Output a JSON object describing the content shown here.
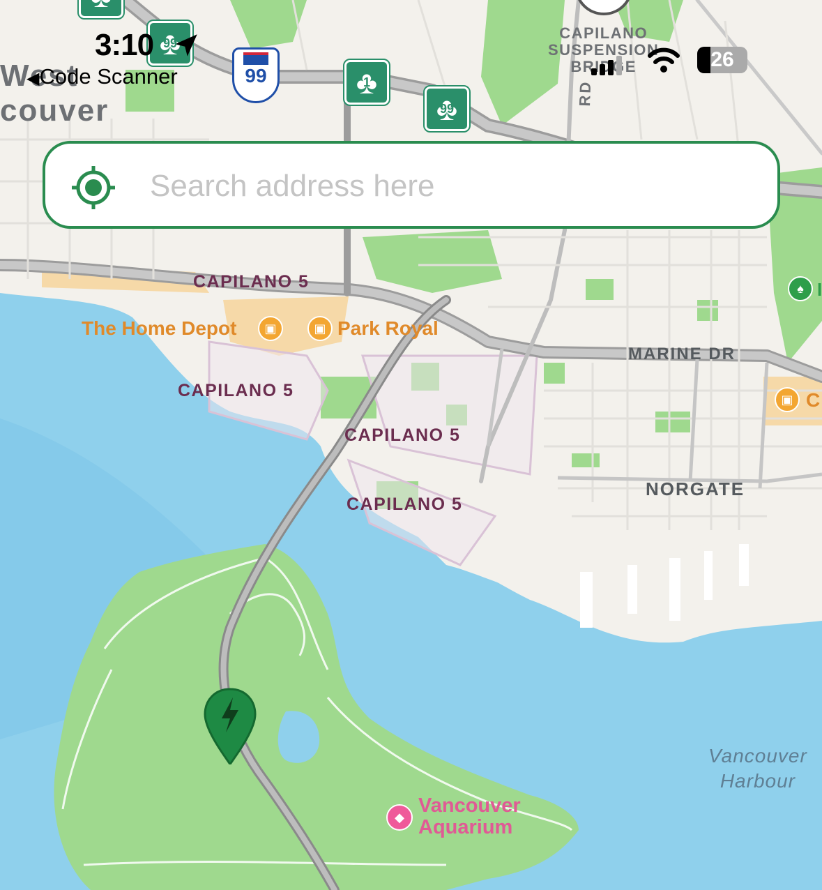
{
  "status_bar": {
    "time": "3:10",
    "back_label": "Code Scanner",
    "battery": "26",
    "battery_fraction": 0.26
  },
  "search": {
    "placeholder": "Search address here"
  },
  "map": {
    "place_labels": {
      "west_vancouver_1": "West",
      "west_vancouver_2": "couver",
      "capilano_bridge_1": "CAPILANO",
      "capilano_bridge_2": "SUSPENSION",
      "capilano_bridge_3": "BRIDGE",
      "rd": "RD"
    },
    "district_labels": [
      "CAPILANO 5",
      "CAPILANO 5",
      "CAPILANO 5",
      "CAPILANO 5"
    ],
    "streets": {
      "marine_dr": "MARINE DR",
      "norgate": "NORGATE"
    },
    "pois": {
      "home_depot": "The Home Depot",
      "park_royal": "Park Royal",
      "partial_store": "C",
      "partial_park": "I",
      "aquarium_line1": "Vancouver",
      "aquarium_line2": "Aquarium"
    },
    "water": {
      "harbour_line1": "Vancouver",
      "harbour_line2": "Harbour"
    },
    "highway_shields": [
      "1",
      "99",
      "99",
      "99",
      "1"
    ]
  },
  "colors": {
    "accent_green": "#2a8c4f",
    "water": "#8fd0ec",
    "park": "#9fd98e",
    "marker": "#1e8a44"
  }
}
